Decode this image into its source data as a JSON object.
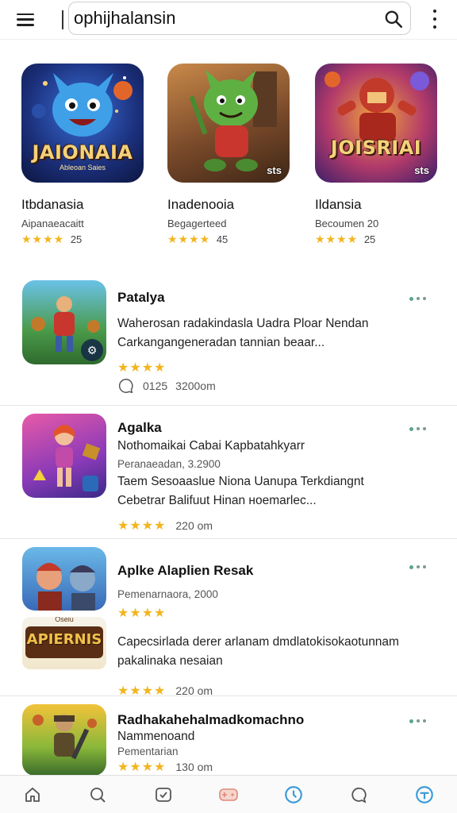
{
  "search": {
    "value": "ophijhalansin"
  },
  "featured": [
    {
      "art_label": "JAIONAIA",
      "art_sub": "Ableoan Saies",
      "corner": "",
      "title": "Itbdanasia",
      "subtitle": "Aipanaeacaitt",
      "rating": "25"
    },
    {
      "art_label": "",
      "art_sub": "",
      "corner": "sts",
      "title": "Inadenooia",
      "subtitle": "Begagerteed",
      "rating": "45"
    },
    {
      "art_label": "JOISRIAI",
      "art_sub": "",
      "corner": "sts",
      "title": "Ildansia",
      "subtitle": "Becoumen 20",
      "rating": "25"
    }
  ],
  "list": [
    {
      "title": "Patalya",
      "line1": "Waherosan radakindasla Uadra Ploar Nendan",
      "line2": "Carkangangeneradan tannian beaar...",
      "meta": "",
      "extra": "",
      "stat1": "0125",
      "stat2": "3200om"
    },
    {
      "title": "Agalka",
      "subtitle": "Nothomaikai Cabai Kapbatahkyarr",
      "meta": "Peranaeadan, 3.2900",
      "line1": "Taem Sesoaaslue Niona Uanupa Terkdiangnt",
      "line2": "Cebetrar Balifuut Hinan ноemarlec...",
      "stat2": "220 om"
    },
    {
      "title": "Aplke Alaplien Resak",
      "meta": "Pemenarnaora, 2000",
      "art_label": "APIERNIS",
      "art_top": "Oseiu",
      "line1": "Capecsirlada derer arlanam dmdlatokisokaotunnam",
      "line2": "pakalinaka nesaian",
      "stat2": "220 om"
    },
    {
      "title": "Radhakahehalmadkomachno",
      "subtitle": "Nammenoand",
      "meta": "Pementarian",
      "stat2": "130 om"
    }
  ],
  "colors": {
    "star": "#f2b51d",
    "accent": "#3a9bd9",
    "dot": "#5aa58e"
  }
}
